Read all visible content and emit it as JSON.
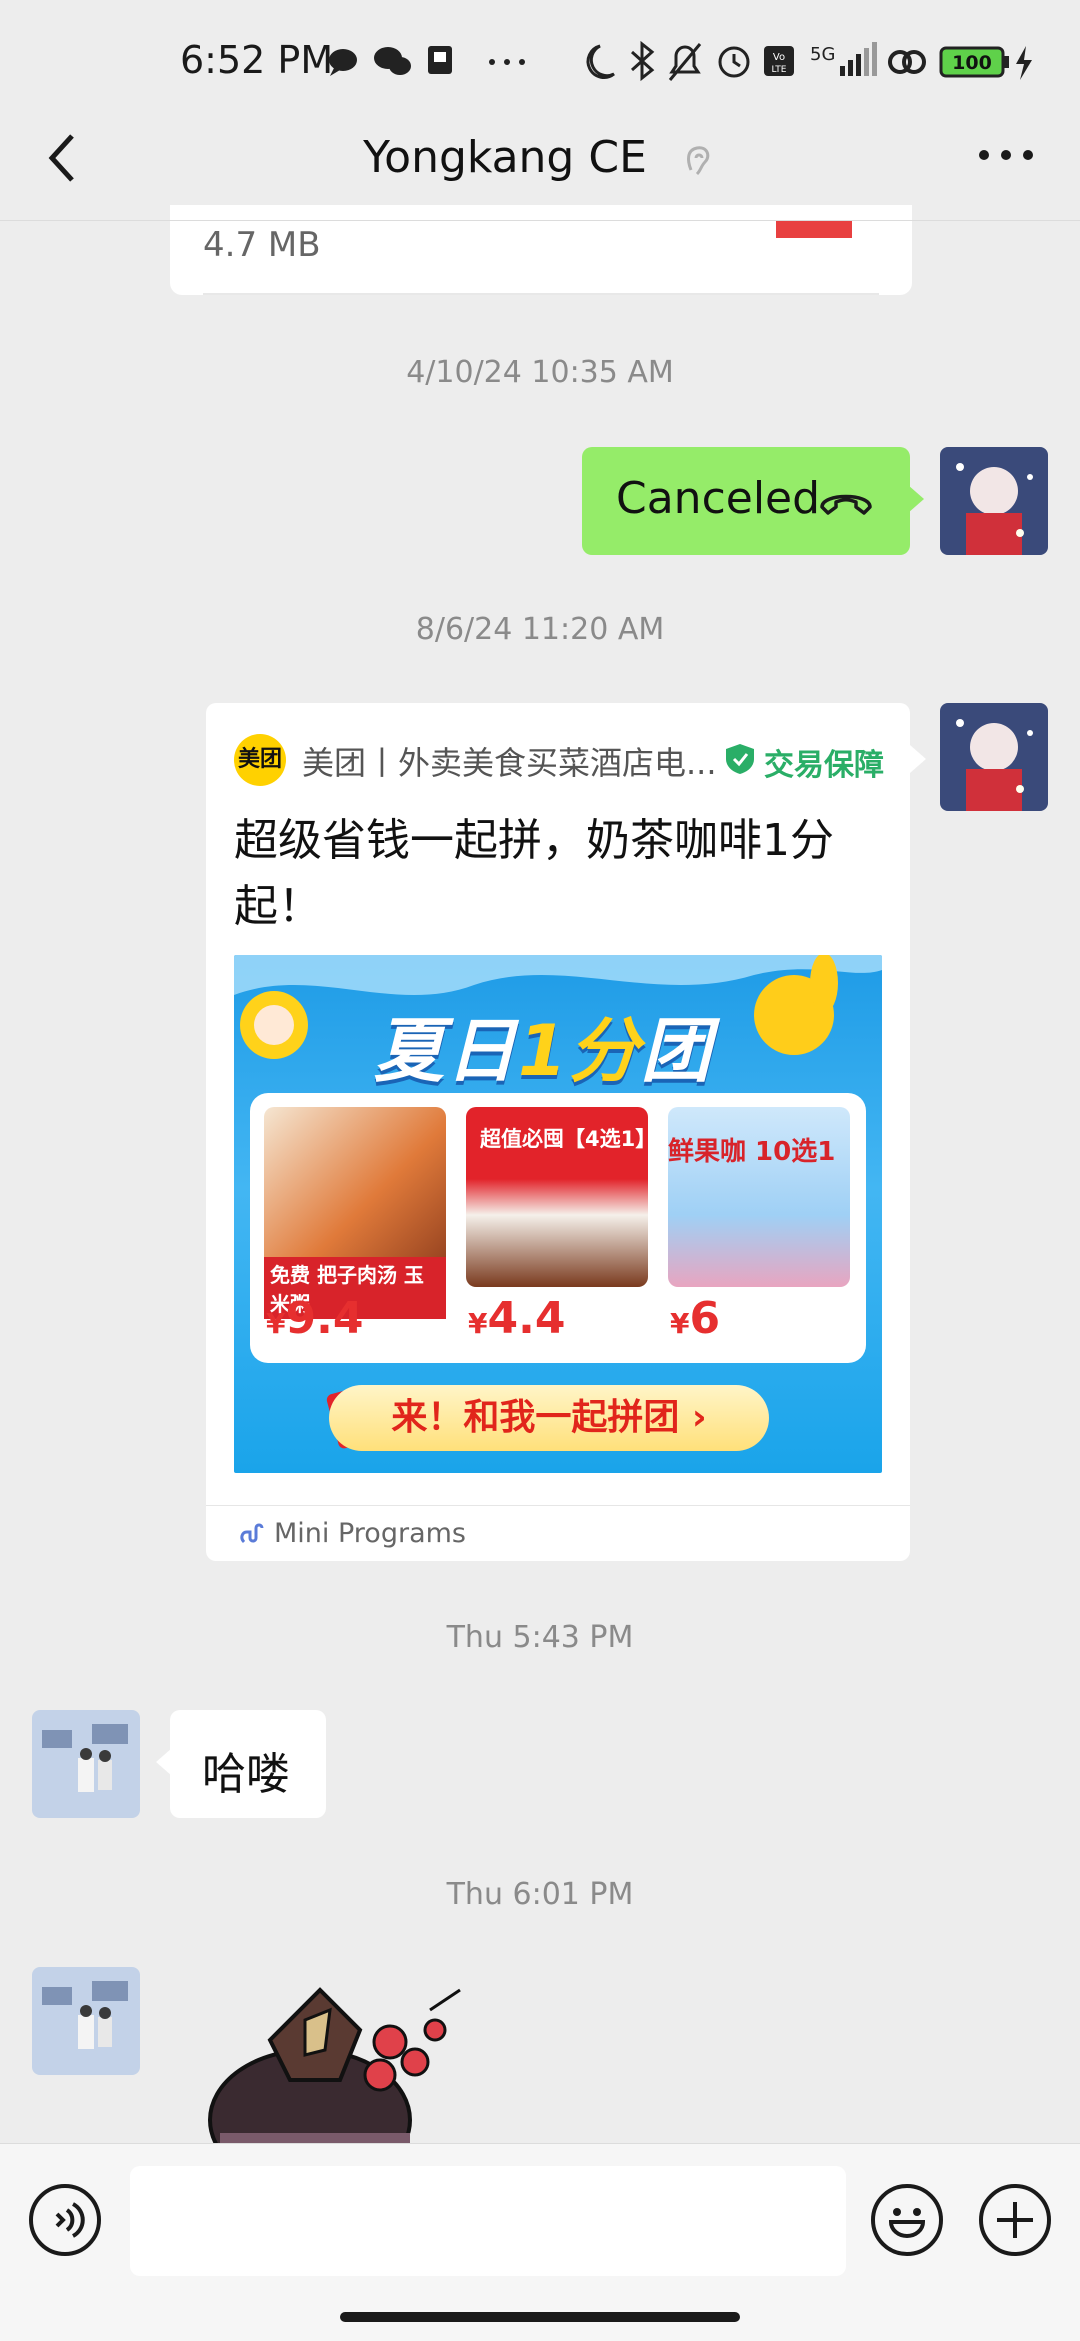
{
  "status_bar": {
    "time": "6:52 PM",
    "battery": "100",
    "network": "5G"
  },
  "header": {
    "title": "Yongkang CE"
  },
  "messages": {
    "file_size": "4.7 MB",
    "ts1": "4/10/24 10:35 AM",
    "call_text": "Canceled",
    "ts2": "8/6/24 11:20 AM",
    "mini_program": {
      "logo_text": "美团",
      "source": "美团丨外卖美食买菜酒店电...",
      "badge": "交易保障",
      "title": "超级省钱一起拼，奶茶咖啡1分起！",
      "banner_title_a": "夏日",
      "banner_title_b": "1分",
      "banner_title_c": "团",
      "products": [
        {
          "label": "免费 把子肉汤 玉米粥",
          "price_symbol": "¥",
          "price": "9.4"
        },
        {
          "label": "超值必囤【4选1】",
          "price_symbol": "¥",
          "price": "4.4"
        },
        {
          "label": "鲜果咖 10选1",
          "price_symbol": "¥",
          "price": "6"
        }
      ],
      "cta": "来！和我一起拼团 ›",
      "footer": "Mini Programs"
    },
    "ts3": "Thu 5:43 PM",
    "hello": "哈喽",
    "ts4": "Thu 6:01 PM"
  },
  "input_bar": {
    "placeholder": ""
  },
  "colors": {
    "bubble_out": "#95ec69",
    "background": "#ededed",
    "badge_green": "#2aae67"
  }
}
